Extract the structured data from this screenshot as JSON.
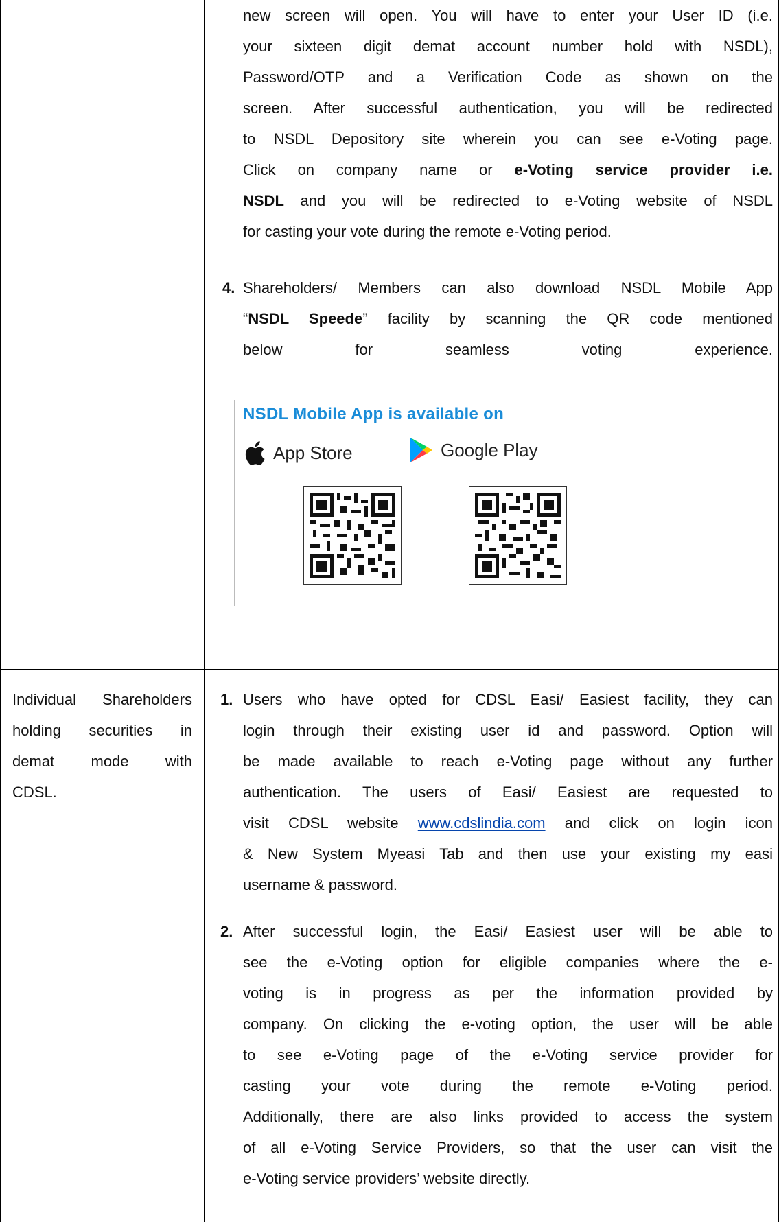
{
  "row1": {
    "para3_lines": [
      "new screen will open. You will have to enter your User ID (i.e.",
      "your sixteen digit demat account number hold with NSDL),",
      "Password/OTP and a Verification Code as shown on the",
      "screen. After successful authentication, you will be redirected",
      "to NSDL Depository site wherein you can see e-Voting page.",
      "Click on company name or ",
      "e-Voting service provider i.e.",
      "NSDL",
      " and you will be redirected to e-Voting website of NSDL",
      "for casting your vote during the remote e-Voting period."
    ],
    "item4": {
      "number": "4.",
      "line1": "Shareholders/ Members can also download NSDL Mobile App",
      "line2_pre": "“",
      "line2_bold": "NSDL Speede",
      "line2_post": "” facility by scanning the QR code mentioned",
      "line3_words": [
        "below",
        "for",
        "seamless",
        "voting",
        "experience."
      ]
    },
    "app_banner": {
      "heading": "NSDL Mobile App is available on",
      "app_store": "App Store",
      "google_play": "Google Play"
    }
  },
  "row2": {
    "left_lines": [
      "Individual Shareholders",
      "holding securities in",
      "demat mode with",
      "CDSL."
    ],
    "item1": {
      "number": "1.",
      "lines": [
        "Users who have opted for CDSL Easi/ Easiest facility, they can",
        "login through their existing user id and password. Option will",
        "be made available to reach e-Voting page without any further",
        "authentication. The users of Easi/ Easiest are requested to"
      ],
      "line5_pre": "visit CDSL website ",
      "link": "www.cdslindia.com",
      "line5_post": " and click on login icon",
      "line6": "& New System Myeasi Tab and then use your existing my easi",
      "line7": "username & password."
    },
    "item2": {
      "number": "2.",
      "lines": [
        "After successful login, the Easi/ Easiest user will be able to",
        "see the e-Voting option for eligible companies where the e-",
        "voting is in progress as per the information provided by",
        "company. On clicking the e-voting option, the user will be able",
        "to see e-Voting page of the e-Voting service provider for",
        "casting your vote during the remote e-Voting period.",
        "Additionally, there are also links provided to access the system",
        "of all e-Voting Service Providers, so that the user can visit the",
        "e-Voting service providers’ website directly."
      ]
    }
  },
  "colors": {
    "link": "#0645ad",
    "app_heading": "#1a8cd8",
    "border": "#000000"
  }
}
